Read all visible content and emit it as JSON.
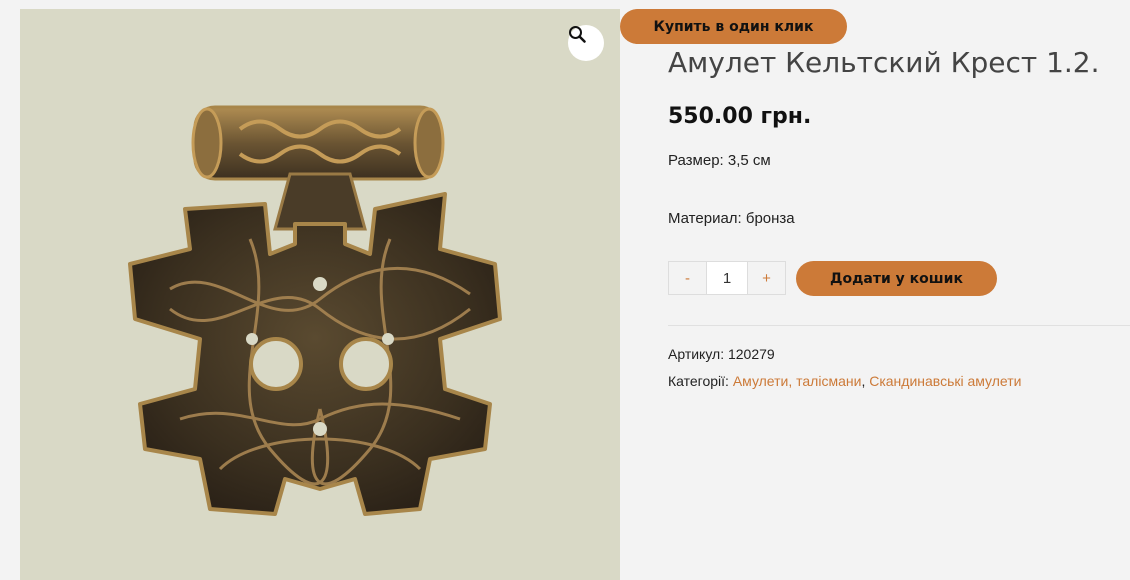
{
  "product": {
    "title": "Амулет Кельтский Крест 1.2.",
    "price": "550.00 грн.",
    "image_alt": "Амулет Кельтский Крест",
    "attributes": [
      "Размер: 3,5 см",
      "Материал: бронза"
    ]
  },
  "actions": {
    "one_click_label": "Купить в один клик",
    "add_to_cart_label": "Додати у кошик",
    "qty_minus": "-",
    "qty_plus": "+",
    "quantity": "1"
  },
  "meta": {
    "sku_label": "Артикул:",
    "sku": "120279",
    "categories_label": "Категорії:",
    "categories": [
      "Амулети, талісмани",
      "Скандинавські амулети"
    ],
    "separator": ","
  },
  "icons": {
    "zoom": "magnifier-icon"
  },
  "colors": {
    "accent": "#cc7a38",
    "background": "#f3f3f3",
    "image_background": "#d9d9c6"
  }
}
